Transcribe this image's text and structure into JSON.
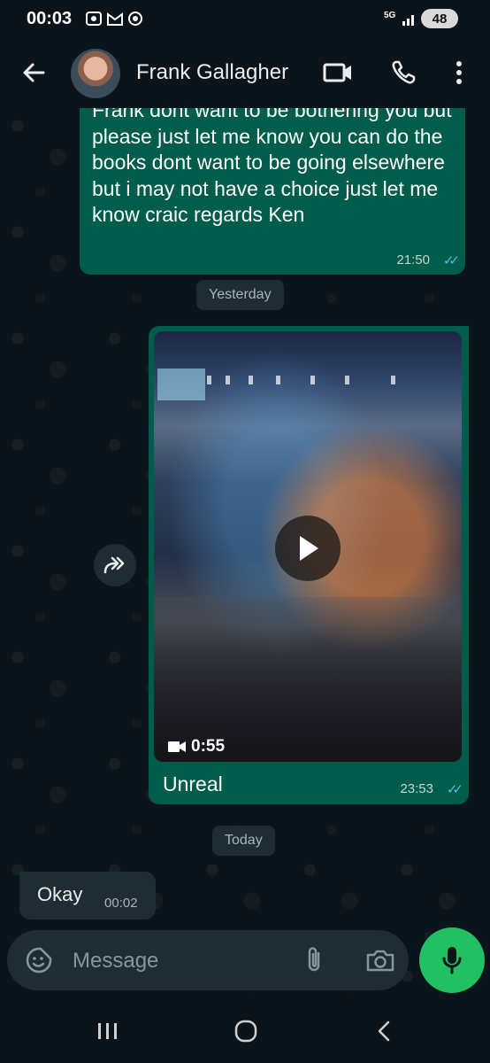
{
  "status_bar": {
    "time": "00:03",
    "network": "5G",
    "battery": "48"
  },
  "header": {
    "contact_name": "Frank Gallagher",
    "icons": [
      "back-arrow-icon",
      "video-call-icon",
      "phone-icon",
      "more-vert-icon"
    ]
  },
  "messages": {
    "outgoing_text": {
      "text": "Frank dont want to be bothering you but please just let me know you can do the books dont want to be going elsewhere but i may not have a choice just let me know craic regards Ken",
      "time": "21:50",
      "ticks": "✓✓"
    },
    "date_yesterday": "Yesterday",
    "outgoing_video": {
      "duration": "0:55",
      "caption": "Unreal",
      "time": "23:53",
      "ticks": "✓✓"
    },
    "date_today": "Today",
    "incoming_text": {
      "text": "Okay",
      "time": "00:02"
    }
  },
  "composer": {
    "placeholder": "Message",
    "icons": [
      "sticker-icon",
      "paperclip-icon",
      "camera-icon",
      "mic-icon"
    ]
  },
  "colors": {
    "background": "#0b141a",
    "outgoing_bubble": "#005c4b",
    "incoming_bubble": "#202c33",
    "read_tick": "#53bdeb",
    "accent_green": "#21c063"
  }
}
